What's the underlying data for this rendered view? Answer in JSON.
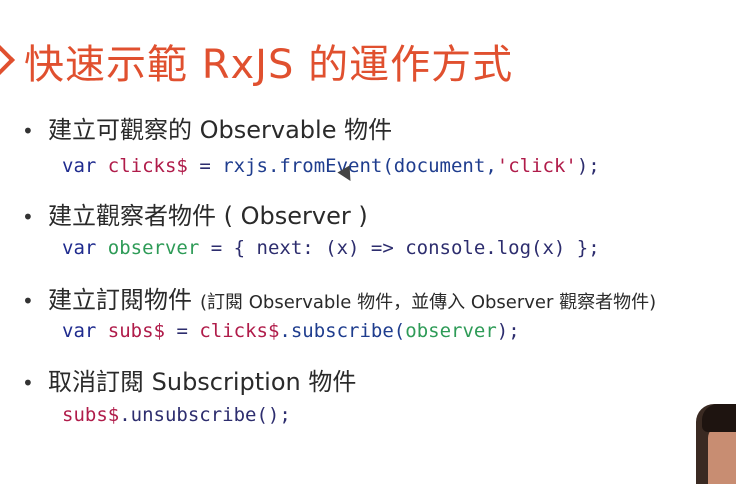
{
  "title": "快速示範 RxJS 的運作方式",
  "bullets": [
    {
      "text": "建立可觀察的 Observable 物件"
    },
    {
      "text": "建立觀察者物件 ( Observer )"
    },
    {
      "text": "建立訂閱物件",
      "note": "(訂閱 Observable 物件，並傳入 Observer 觀察者物件)"
    },
    {
      "text": "取消訂閱 Subscription 物件"
    }
  ],
  "code": {
    "line1": [
      "var",
      "clicks$",
      "=",
      "rxjs.fromEvent(document,",
      "'click'",
      ");"
    ],
    "line2": [
      "var",
      "observer",
      "= { next: (x) => console.log(x) };"
    ],
    "line3": [
      "var",
      "subs$",
      "=",
      "clicks$",
      ".subscribe(",
      "observer",
      ");"
    ],
    "line4": [
      "subs$",
      ".unsubscribe();"
    ]
  },
  "colors": {
    "title": "#e0502f",
    "keyword": "#1f2b8e",
    "variable": "#b01c4a",
    "observer": "#2e9b57"
  }
}
